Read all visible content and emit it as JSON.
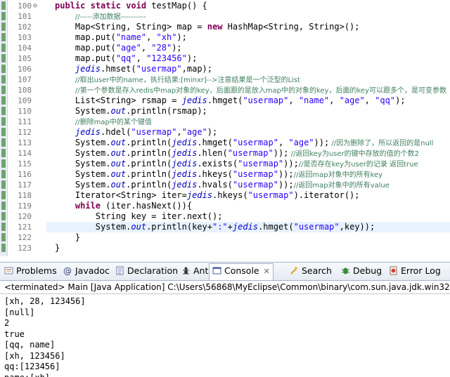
{
  "editor": {
    "lines": [
      {
        "n": "100",
        "fold": "⊖",
        "parts": [
          [
            "kw",
            "public static void "
          ],
          [
            "",
            "testMap() {"
          ]
        ]
      },
      {
        "n": "101",
        "parts": [
          [
            "",
            "    "
          ],
          [
            "cm",
            "//-----添加数据----------"
          ]
        ]
      },
      {
        "n": "102",
        "parts": [
          [
            "",
            "    Map<String, String> map = "
          ],
          [
            "kw",
            "new"
          ],
          [
            "",
            " HashMap<String, String>();"
          ]
        ]
      },
      {
        "n": "103",
        "parts": [
          [
            "",
            "    map.put("
          ],
          [
            "str",
            "\"name\""
          ],
          [
            "",
            ", "
          ],
          [
            "str",
            "\"xh\""
          ],
          [
            "",
            ");"
          ]
        ]
      },
      {
        "n": "104",
        "parts": [
          [
            "",
            "    map.put("
          ],
          [
            "str",
            "\"age\""
          ],
          [
            "",
            ", "
          ],
          [
            "str",
            "\"28\""
          ],
          [
            "",
            ");"
          ]
        ]
      },
      {
        "n": "105",
        "parts": [
          [
            "",
            "    map.put("
          ],
          [
            "str",
            "\"qq\""
          ],
          [
            "",
            ", "
          ],
          [
            "str",
            "\"123456\""
          ],
          [
            "",
            ");"
          ]
        ]
      },
      {
        "n": "106",
        "parts": [
          [
            "",
            "    "
          ],
          [
            "it",
            "jedis"
          ],
          [
            "",
            ".hmset("
          ],
          [
            "str",
            "\"usermap\""
          ],
          [
            "",
            ",map);"
          ]
        ]
      },
      {
        "n": "107",
        "parts": [
          [
            "",
            "    "
          ],
          [
            "cm",
            "//取出user中的name，执行结果:[minxr]-->注意结果是一个泛型的List"
          ]
        ]
      },
      {
        "n": "108",
        "parts": [
          [
            "",
            "    "
          ],
          [
            "cm",
            "//第一个参数是存入redis中map对象的key，后面跟的是放入map中的对象的key，后面的key可以跟多个，是可变参数"
          ]
        ]
      },
      {
        "n": "109",
        "parts": [
          [
            "",
            "    List<String> rsmap = "
          ],
          [
            "it",
            "jedis"
          ],
          [
            "",
            ".hmget("
          ],
          [
            "str",
            "\"usermap\""
          ],
          [
            "",
            ", "
          ],
          [
            "str",
            "\"name\""
          ],
          [
            "",
            ", "
          ],
          [
            "str",
            "\"age\""
          ],
          [
            "",
            ", "
          ],
          [
            "str",
            "\"qq\""
          ],
          [
            "",
            ");"
          ]
        ]
      },
      {
        "n": "110",
        "parts": [
          [
            "",
            "    System."
          ],
          [
            "fld",
            "out"
          ],
          [
            "",
            ".println(rsmap);"
          ]
        ]
      },
      {
        "n": "111",
        "parts": [
          [
            "",
            "    "
          ],
          [
            "cm",
            "//删除map中的某个键值"
          ]
        ]
      },
      {
        "n": "112",
        "parts": [
          [
            "",
            "    "
          ],
          [
            "it",
            "jedis"
          ],
          [
            "",
            ".hdel("
          ],
          [
            "str",
            "\"usermap\""
          ],
          [
            "",
            ","
          ],
          [
            "str",
            "\"age\""
          ],
          [
            "",
            ");"
          ]
        ]
      },
      {
        "n": "113",
        "parts": [
          [
            "",
            "    System."
          ],
          [
            "fld",
            "out"
          ],
          [
            "",
            ".println("
          ],
          [
            "it",
            "jedis"
          ],
          [
            "",
            ".hmget("
          ],
          [
            "str",
            "\"usermap\""
          ],
          [
            "",
            ", "
          ],
          [
            "str",
            "\"age\""
          ],
          [
            "",
            "));"
          ],
          [
            "cm",
            " //因为删除了，所以返回的是null"
          ]
        ]
      },
      {
        "n": "114",
        "parts": [
          [
            "",
            "    System."
          ],
          [
            "fld",
            "out"
          ],
          [
            "",
            ".println("
          ],
          [
            "it",
            "jedis"
          ],
          [
            "",
            ".hlen("
          ],
          [
            "str",
            "\"usermap\""
          ],
          [
            "",
            "));"
          ],
          [
            "cm",
            " //返回key为user的键中存放的值的个数2"
          ]
        ]
      },
      {
        "n": "115",
        "parts": [
          [
            "",
            "    System."
          ],
          [
            "fld",
            "out"
          ],
          [
            "",
            ".println("
          ],
          [
            "it",
            "jedis"
          ],
          [
            "",
            ".exists("
          ],
          [
            "str",
            "\"usermap\""
          ],
          [
            "",
            "));"
          ],
          [
            "cm",
            "//是否存在key为user的记录 返回true"
          ]
        ]
      },
      {
        "n": "116",
        "parts": [
          [
            "",
            "    System."
          ],
          [
            "fld",
            "out"
          ],
          [
            "",
            ".println("
          ],
          [
            "it",
            "jedis"
          ],
          [
            "",
            ".hkeys("
          ],
          [
            "str",
            "\"usermap\""
          ],
          [
            "",
            "));"
          ],
          [
            "cm",
            "//返回map对象中的所有key"
          ]
        ]
      },
      {
        "n": "117",
        "parts": [
          [
            "",
            "    System."
          ],
          [
            "fld",
            "out"
          ],
          [
            "",
            ".println("
          ],
          [
            "it",
            "jedis"
          ],
          [
            "",
            ".hvals("
          ],
          [
            "str",
            "\"usermap\""
          ],
          [
            "",
            "));"
          ],
          [
            "cm",
            "//返回map对象中的所有value"
          ]
        ]
      },
      {
        "n": "118",
        "parts": [
          [
            "",
            "    Iterator<String> iter="
          ],
          [
            "it",
            "jedis"
          ],
          [
            "",
            ".hkeys("
          ],
          [
            "str",
            "\"usermap\""
          ],
          [
            "",
            ").iterator();"
          ]
        ]
      },
      {
        "n": "119",
        "parts": [
          [
            "",
            "    "
          ],
          [
            "kw",
            "while"
          ],
          [
            "",
            " (iter.hasNext()){"
          ]
        ]
      },
      {
        "n": "120",
        "parts": [
          [
            "",
            "        String key = iter.next();"
          ]
        ]
      },
      {
        "n": "121",
        "parts": [
          [
            "",
            "        System."
          ],
          [
            "fld",
            "out"
          ],
          [
            "",
            ".println(key+"
          ],
          [
            "str",
            "\":\""
          ],
          [
            "",
            "+"
          ],
          [
            "it",
            "jedis"
          ],
          [
            "",
            ".hmget("
          ],
          [
            "str",
            "\"usermap\""
          ],
          [
            "",
            ",key));"
          ]
        ]
      },
      {
        "n": "122",
        "parts": [
          [
            "",
            "    }"
          ]
        ]
      },
      {
        "n": "123",
        "parts": [
          [
            "",
            "}"
          ]
        ]
      }
    ],
    "current_line": "121"
  },
  "console_tabs": [
    {
      "label": "Problems",
      "icon": "problems-icon",
      "active": false
    },
    {
      "label": "Javadoc",
      "icon": "at-icon",
      "active": false
    },
    {
      "label": "Declaration",
      "icon": "declaration-icon",
      "active": false
    },
    {
      "label": "Ant",
      "icon": "ant-icon",
      "active": false
    },
    {
      "label": "Console",
      "icon": "console-icon",
      "active": true,
      "close": "✕"
    },
    {
      "label": "Search",
      "icon": "search-icon",
      "active": false
    },
    {
      "label": "Debug",
      "icon": "bug-icon",
      "active": false
    },
    {
      "label": "Error Log",
      "icon": "error-log-icon",
      "active": false
    }
  ],
  "console_status": "<terminated> Main [Java Application] C:\\Users\\56868\\MyEclipse\\Common\\binary\\com.sun.java.jdk.win32.x86",
  "console_output": [
    "[xh, 28, 123456]",
    "[null]",
    "2",
    "true",
    "[qq, name]",
    "[xh, 123456]",
    "qq:[123456]",
    "name:[xh]"
  ],
  "colors": {
    "keyword": "#7f0055",
    "string": "#2a00ff",
    "comment": "#3f7f5f",
    "field": "#0000c0"
  }
}
